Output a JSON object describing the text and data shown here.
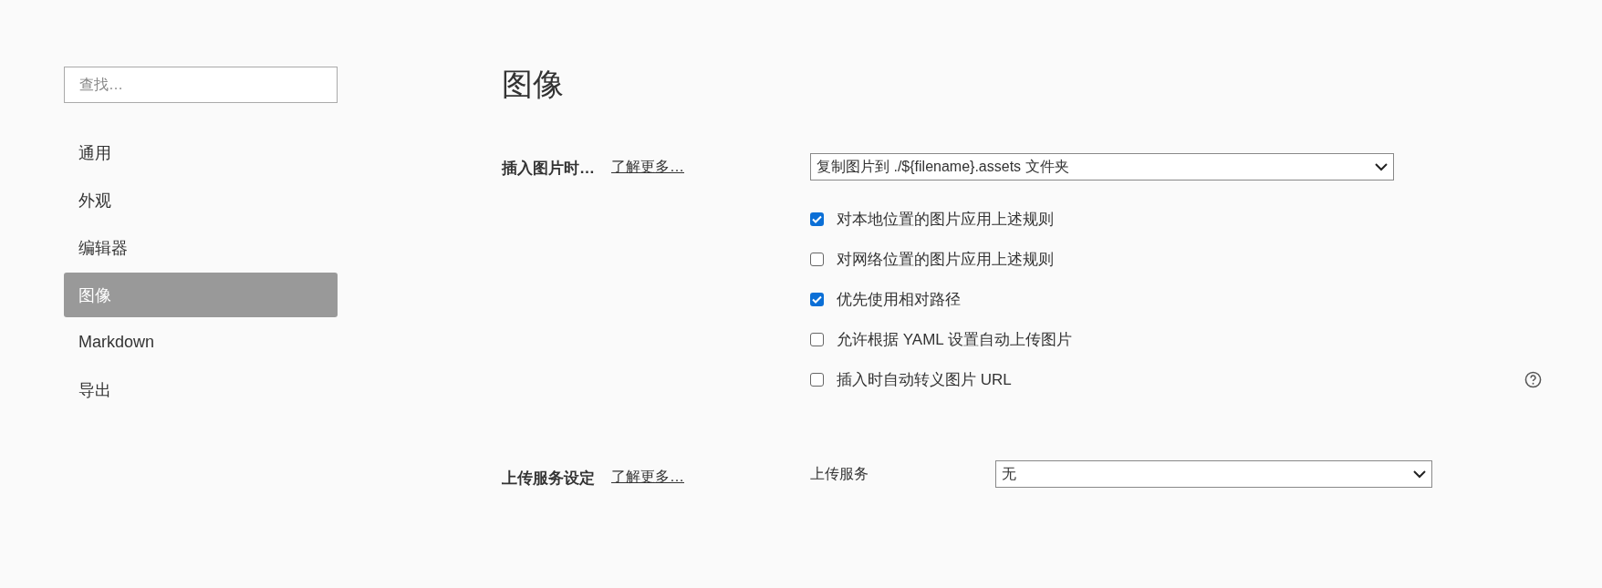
{
  "sidebar": {
    "search": {
      "placeholder": "查找…"
    },
    "items": [
      {
        "label": "通用",
        "selected": false
      },
      {
        "label": "外观",
        "selected": false
      },
      {
        "label": "编辑器",
        "selected": false
      },
      {
        "label": "图像",
        "selected": true
      },
      {
        "label": "Markdown",
        "selected": false
      },
      {
        "label": "导出",
        "selected": false
      }
    ]
  },
  "page": {
    "title": "图像",
    "sections": [
      {
        "label": "插入图片时…",
        "link": "了解更多…",
        "select": {
          "value": "复制图片到 ./${filename}.assets 文件夹"
        },
        "options": [
          {
            "label": "对本地位置的图片应用上述规则",
            "checked": true,
            "help": false
          },
          {
            "label": "对网络位置的图片应用上述规则",
            "checked": false,
            "help": false
          },
          {
            "label": "优先使用相对路径",
            "checked": true,
            "help": false
          },
          {
            "label": "允许根据 YAML 设置自动上传图片",
            "checked": false,
            "help": false
          },
          {
            "label": "插入时自动转义图片 URL",
            "checked": false,
            "help": true
          }
        ]
      },
      {
        "label": "上传服务设定",
        "link": "了解更多…",
        "field_label": "上传服务",
        "select": {
          "value": "无"
        }
      }
    ]
  }
}
